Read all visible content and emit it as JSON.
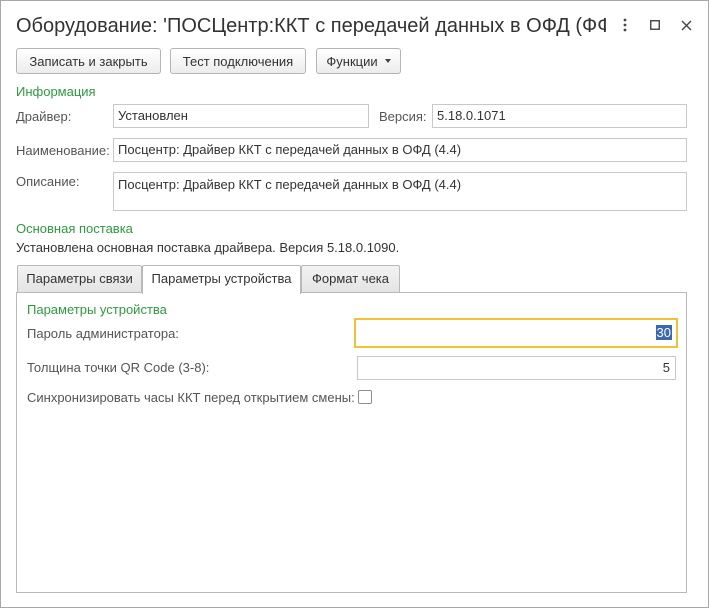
{
  "window": {
    "title": "Оборудование: 'ПОСЦентр:ККТ с передачей данных в ОФД (ФФ...",
    "controls": {
      "menu": "⋮",
      "maximize": "□",
      "close": "✕"
    }
  },
  "toolbar": {
    "save_close_label": "Записать и закрыть",
    "test_connection_label": "Тест подключения",
    "functions_label": "Функции"
  },
  "info": {
    "section_title": "Информация",
    "driver_label": "Драйвер:",
    "driver_value": "Установлен",
    "version_label": "Версия:",
    "version_value": "5.18.0.1071",
    "name_label": "Наименование:",
    "name_value": "Посцентр: Драйвер ККТ с передачей данных в ОФД (4.4)",
    "description_label": "Описание:",
    "description_value": "Посцентр: Драйвер ККТ с передачей данных в ОФД (4.4)"
  },
  "delivery": {
    "section_title": "Основная поставка",
    "status_text": "Установлена основная поставка драйвера. Версия 5.18.0.1090."
  },
  "tabs": [
    {
      "label": "Параметры связи",
      "active": false
    },
    {
      "label": "Параметры устройства",
      "active": true
    },
    {
      "label": "Формат чека",
      "active": false
    }
  ],
  "device_params": {
    "section_title": "Параметры устройства",
    "admin_password_label": "Пароль администратора:",
    "admin_password_value": "30",
    "qr_label": "Толщина точки QR Code (3-8):",
    "qr_value": "5",
    "sync_clock_label": "Синхронизировать часы ККТ перед открытием смены:",
    "sync_clock_checked": false
  },
  "colors": {
    "section_green": "#2d9a3f",
    "focus_border": "#f1c232",
    "selection": "#3a68b4"
  }
}
